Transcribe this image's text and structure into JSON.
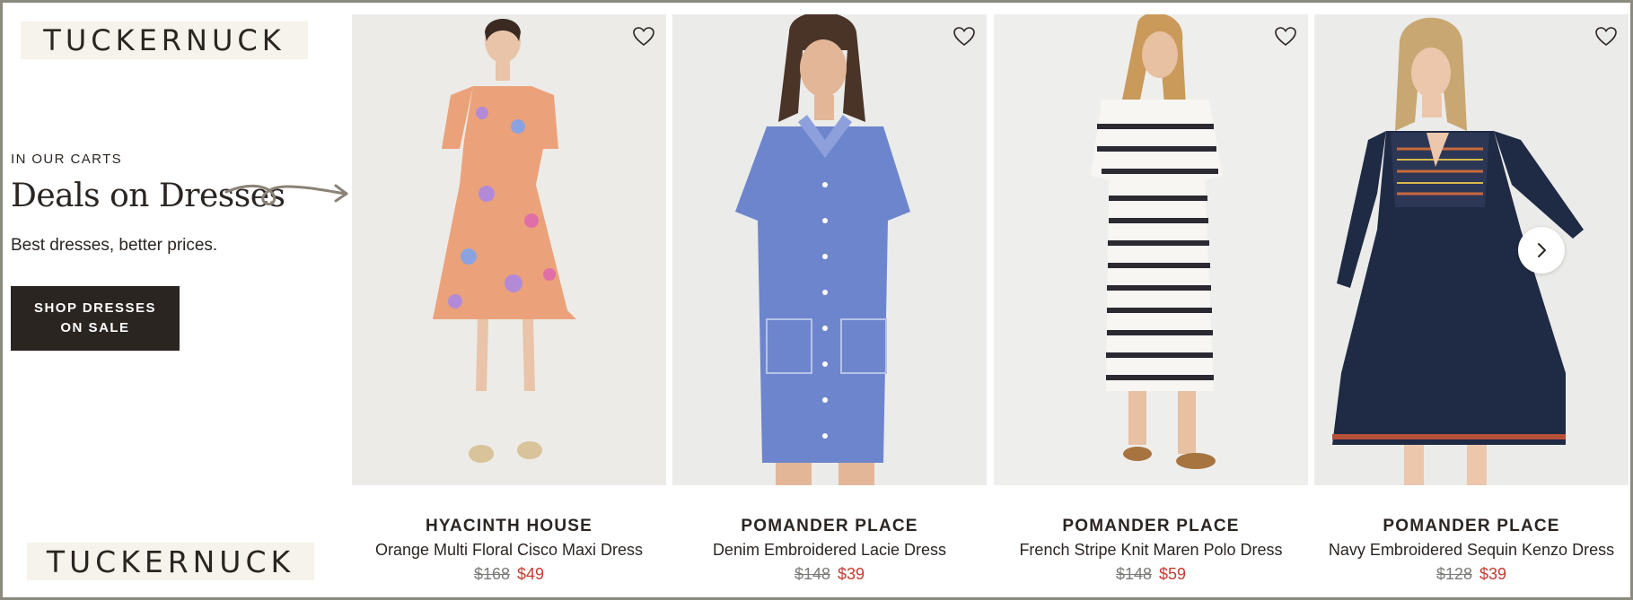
{
  "brand": {
    "logo": "TUCKERNUCK"
  },
  "promo": {
    "eyebrow": "IN OUR CARTS",
    "headline": "Deals on Dresses",
    "subtext": "Best dresses, better prices.",
    "cta_line1": "SHOP DRESSES",
    "cta_line2": "ON SALE"
  },
  "products": [
    {
      "brand": "HYACINTH HOUSE",
      "name": "Orange Multi Floral Cisco Maxi Dress",
      "original_price": "$168",
      "sale_price": "$49"
    },
    {
      "brand": "POMANDER PLACE",
      "name": "Denim Embroidered Lacie Dress",
      "original_price": "$148",
      "sale_price": "$39"
    },
    {
      "brand": "POMANDER PLACE",
      "name": "French Stripe Knit Maren Polo Dress",
      "original_price": "$148",
      "sale_price": "$59"
    },
    {
      "brand": "POMANDER PLACE",
      "name": "Navy Embroidered Sequin Kenzo Dress",
      "original_price": "$128",
      "sale_price": "$39"
    }
  ],
  "icons": {
    "wishlist": "heart-icon",
    "carousel_next": "chevron-right-icon",
    "decoration": "curly-arrow-icon"
  },
  "colors": {
    "text_dark": "#2b2522",
    "sale_red": "#c43b32",
    "logo_bg": "#f6f3ec",
    "strike_gray": "#7a7a78"
  }
}
